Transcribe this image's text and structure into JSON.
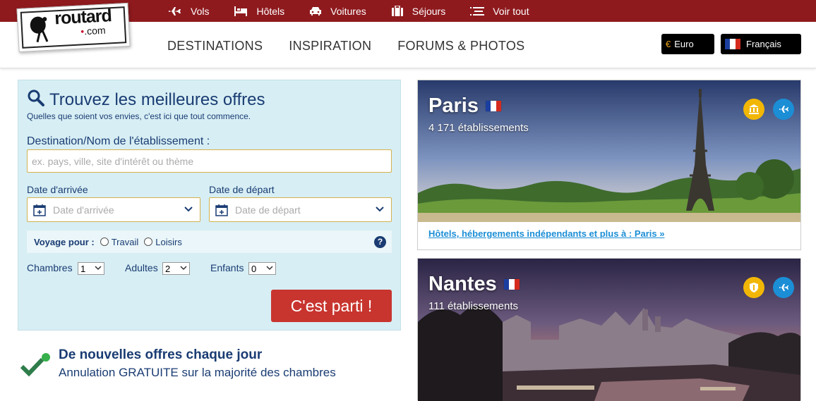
{
  "topnav": [
    {
      "icon": "plane-icon",
      "label": "Vols"
    },
    {
      "icon": "bed-icon",
      "label": "Hôtels"
    },
    {
      "icon": "car-icon",
      "label": "Voitures"
    },
    {
      "icon": "suitcase-icon",
      "label": "Séjours"
    },
    {
      "icon": "list-icon",
      "label": "Voir tout"
    }
  ],
  "logo": {
    "name": "routard",
    "domain": ".com"
  },
  "mainnav": [
    "DESTINATIONS",
    "INSPIRATION",
    "FORUMS & PHOTOS"
  ],
  "currency": {
    "symbol": "€",
    "label": "Euro"
  },
  "language": {
    "label": "Français"
  },
  "search": {
    "title": "Trouvez les meilleures offres",
    "subtitle": "Quelles que soient vos envies, c'est ici que tout commence.",
    "destination_label": "Destination/Nom de l'établissement :",
    "destination_placeholder": "ex. pays, ville, site d'intérêt ou thème",
    "arrival_label": "Date d'arrivée",
    "arrival_placeholder": "Date d'arrivée",
    "departure_label": "Date de départ",
    "departure_placeholder": "Date de départ",
    "voyage_label": "Voyage pour :",
    "voyage_options": [
      "Travail",
      "Loisirs"
    ],
    "help": "?",
    "rooms_label": "Chambres",
    "rooms_value": "1",
    "adults_label": "Adultes",
    "adults_value": "2",
    "children_label": "Enfants",
    "children_value": "0",
    "submit_label": "C'est parti !"
  },
  "offers": {
    "title": "De nouvelles offres chaque jour",
    "subtitle": "Annulation GRATUITE sur la majorité des chambres"
  },
  "cards": [
    {
      "city": "Paris",
      "count": "4 171 établissements",
      "link": "Hôtels, hébergements indépendants et plus à : Paris »"
    },
    {
      "city": "Nantes",
      "count": "111 établissements"
    }
  ],
  "colors": {
    "topbar": "#8e1a1e",
    "accent": "#c8352e",
    "navy": "#1a3c73",
    "badge_yellow": "#f2b705",
    "badge_blue": "#1b8ed6",
    "link": "#1b8ed6"
  }
}
